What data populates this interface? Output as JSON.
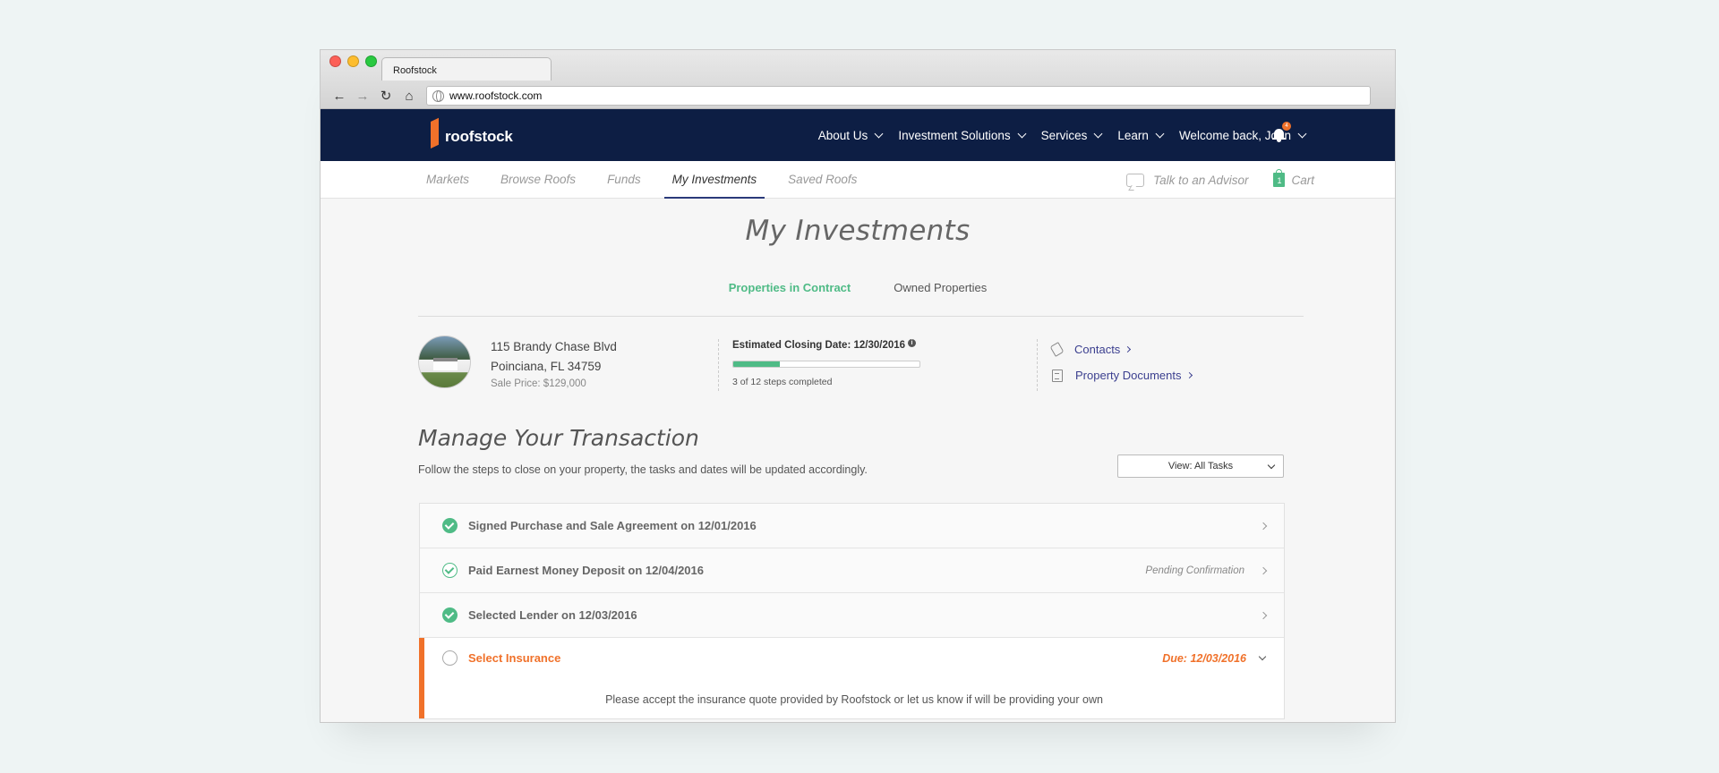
{
  "browser": {
    "tab_title": "Roofstock",
    "url": "www.roofstock.com"
  },
  "header": {
    "logo_text": "roofstock",
    "menu": [
      {
        "label": "About Us"
      },
      {
        "label": "Investment Solutions"
      },
      {
        "label": "Services"
      },
      {
        "label": "Learn"
      },
      {
        "label": "Welcome back, John"
      }
    ],
    "notification_count": "4"
  },
  "subnav": {
    "items": [
      {
        "label": "Markets"
      },
      {
        "label": "Browse Roofs"
      },
      {
        "label": "Funds"
      },
      {
        "label": "My Investments"
      },
      {
        "label": "Saved Roofs"
      }
    ],
    "advisor_label": "Talk to an Advisor",
    "cart_label": "Cart",
    "cart_count": "1"
  },
  "page": {
    "title": "My Investments",
    "tabs": [
      {
        "label": "Properties in Contract"
      },
      {
        "label": "Owned Properties"
      }
    ]
  },
  "property": {
    "address_line1": "115 Brandy Chase Blvd",
    "address_line2": "Poinciana, FL 34759",
    "sale_price": "Sale Price: $129,000",
    "closing_date": "Estimated Closing Date: 12/30/2016",
    "progress_fraction": 0.25,
    "steps_text": "3 of 12 steps completed",
    "contacts_label": "Contacts",
    "documents_label": "Property Documents"
  },
  "transaction": {
    "title": "Manage Your Transaction",
    "description": "Follow the steps to close on your property, the tasks and dates will be updated accordingly.",
    "view_select": "View: All Tasks",
    "tasks": [
      {
        "label": "Signed Purchase and Sale Agreement on 12/01/2016",
        "status": ""
      },
      {
        "label": "Paid Earnest Money Deposit on 12/04/2016",
        "status": "Pending Confirmation"
      },
      {
        "label": "Selected Lender on 12/03/2016",
        "status": ""
      },
      {
        "label": "Select Insurance",
        "due": "Due: 12/03/2016",
        "description": "Please accept the insurance quote provided by Roofstock or let us know if will be providing your own"
      }
    ]
  },
  "colors": {
    "nav_bg": "#0d1e44",
    "accent_green": "#4fbb86",
    "accent_orange": "#f0712a",
    "link": "#3b3f8f"
  }
}
